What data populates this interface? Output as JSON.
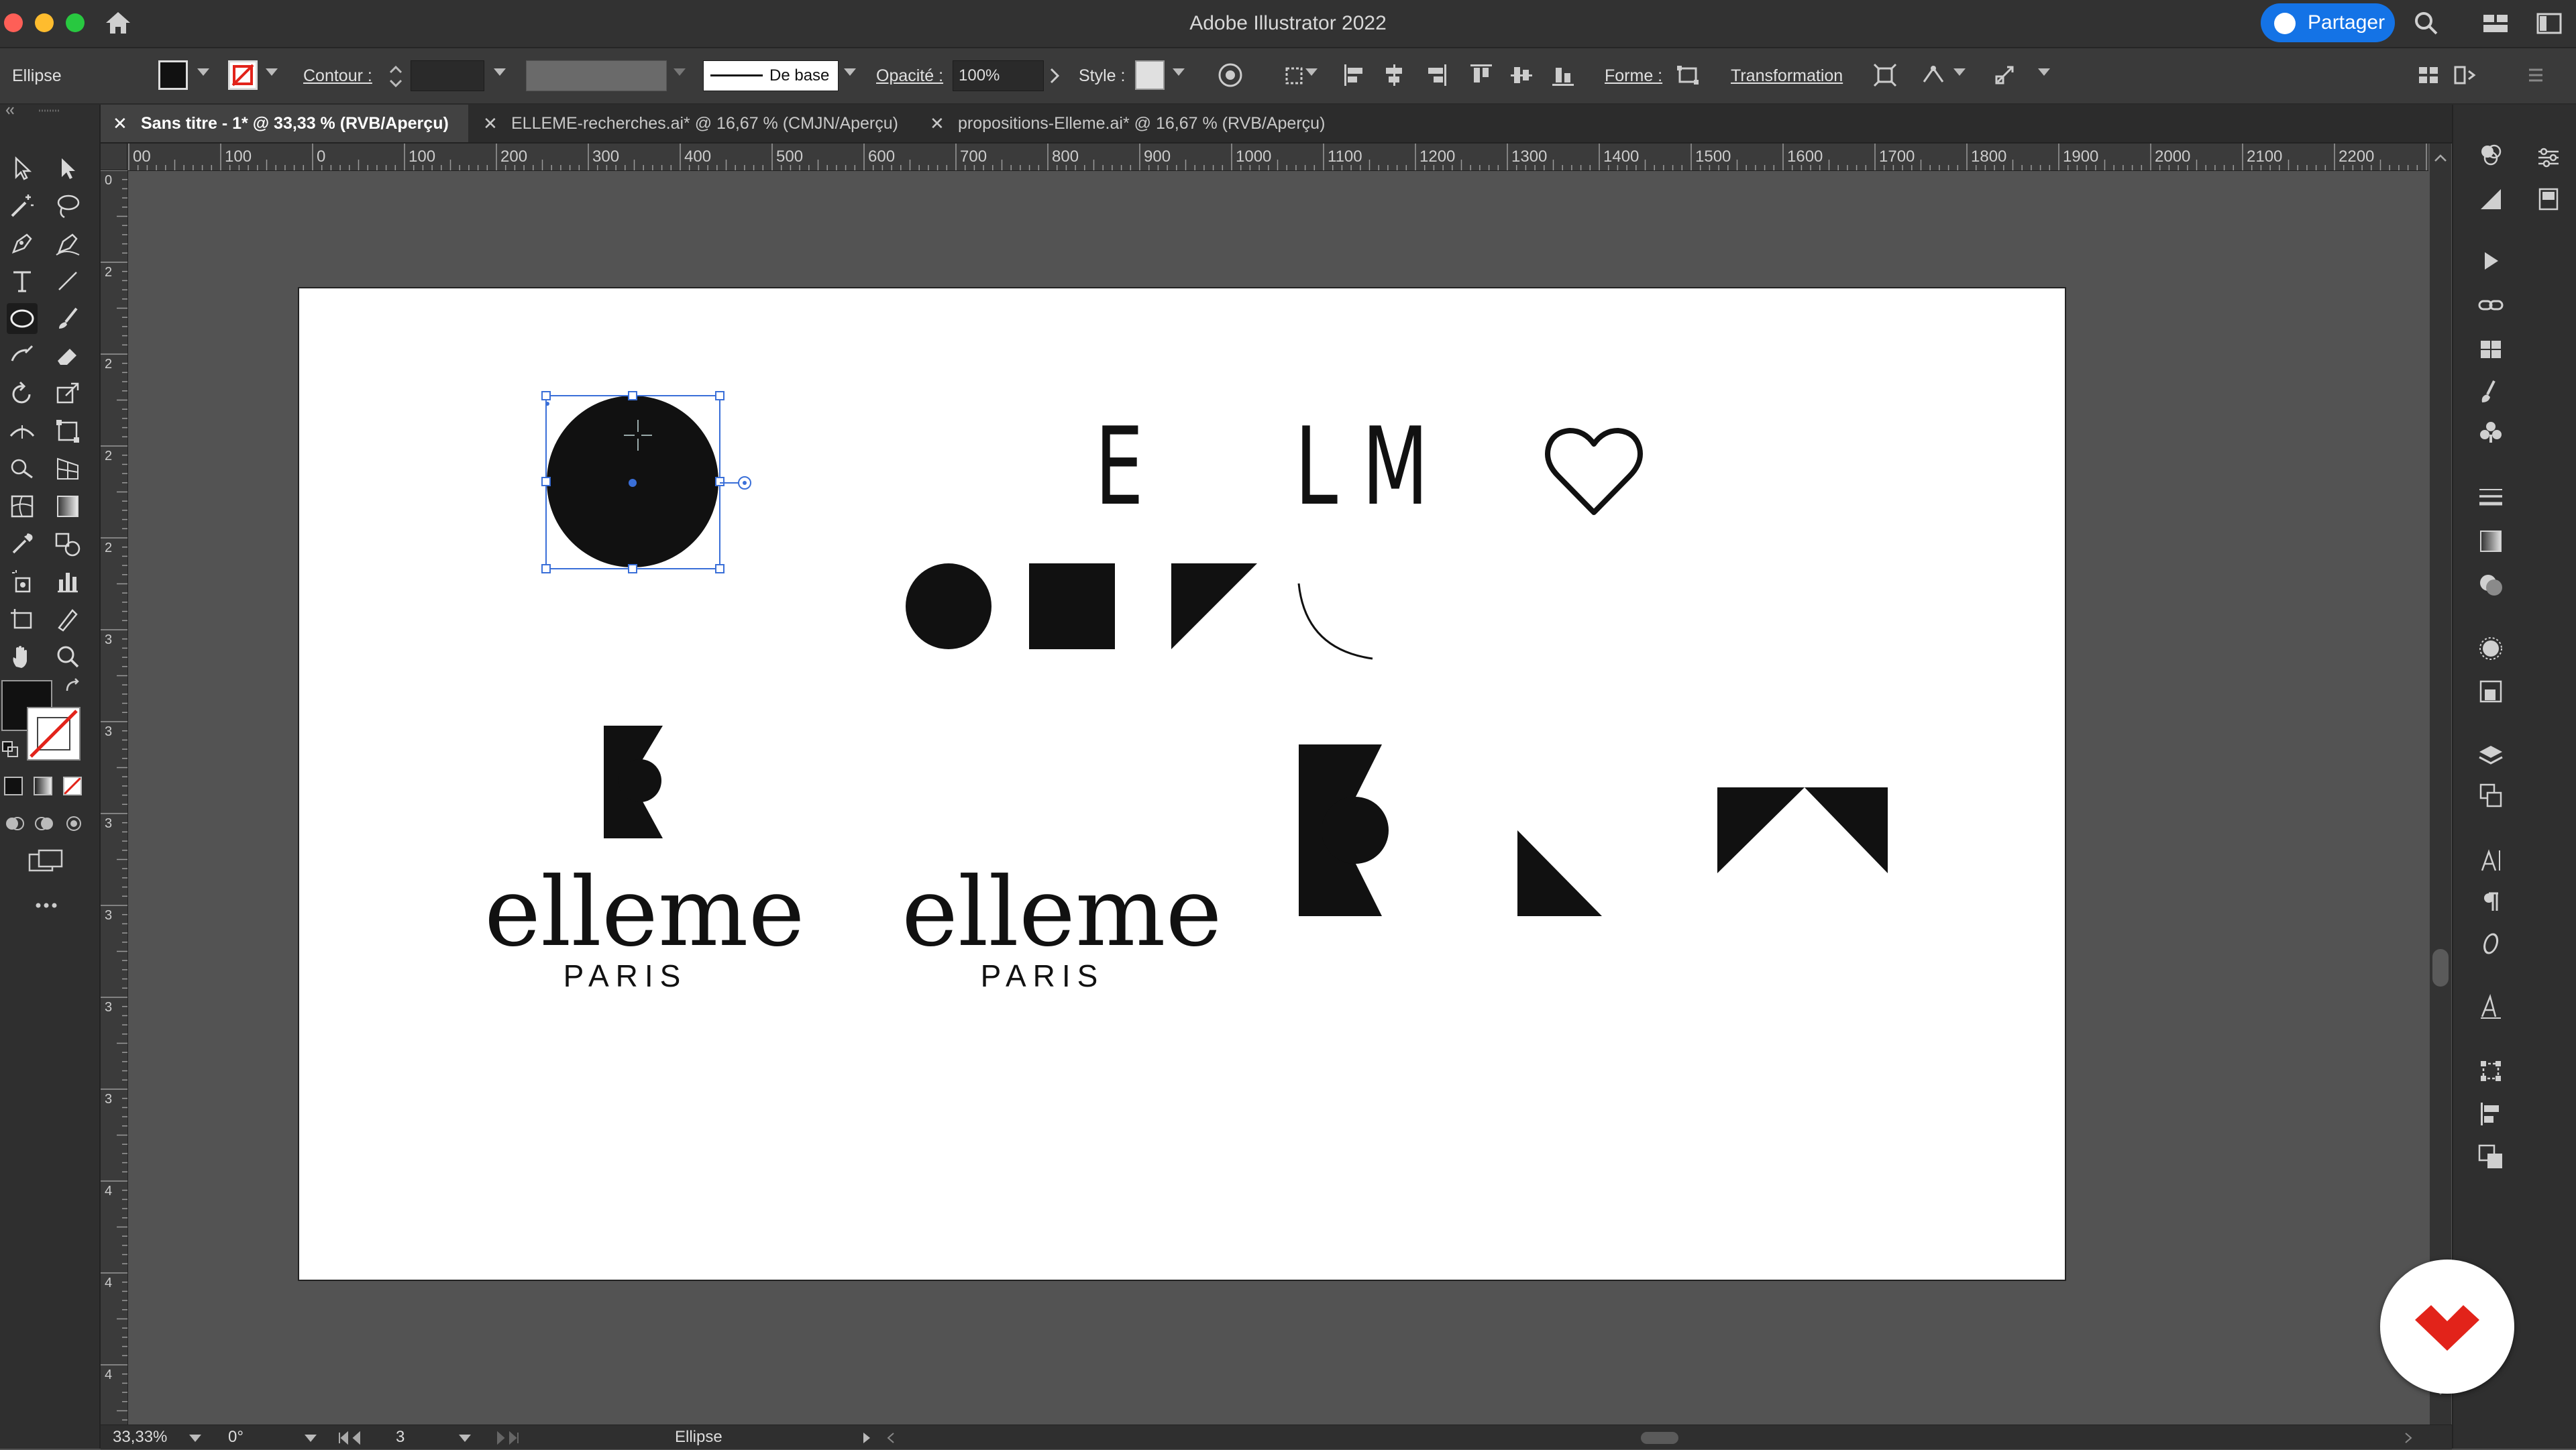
{
  "window": {
    "title": "Adobe Illustrator 2022",
    "share_label": "Partager"
  },
  "controlbar": {
    "selection_label": "Ellipse",
    "stroke_label": "Contour :",
    "brush_value": "De base",
    "opacity_label": "Opacité :",
    "opacity_value": "100%",
    "style_label": "Style :",
    "shape_label": "Forme :",
    "transform_label": "Transformation"
  },
  "tabs": [
    {
      "label": "Sans titre - 1* @ 33,33 % (RVB/Aperçu)",
      "active": true
    },
    {
      "label": "ELLEME-recherches.ai* @ 16,67 % (CMJN/Aperçu)",
      "active": false
    },
    {
      "label": "propositions-Elleme.ai* @ 16,67 % (RVB/Aperçu)",
      "active": false
    }
  ],
  "ruler_h": [
    "00",
    "100",
    "0",
    "100",
    "200",
    "300",
    "400",
    "500",
    "600",
    "700",
    "800",
    "900",
    "1000",
    "1100",
    "1200",
    "1300",
    "1400",
    "1500",
    "1600",
    "1700",
    "1800",
    "1900",
    "2000",
    "2100",
    "2200",
    "2"
  ],
  "ruler_v": [
    "0",
    "2",
    "2",
    "2",
    "2",
    "3",
    "3",
    "3",
    "3",
    "3",
    "3",
    "4",
    "4",
    "4"
  ],
  "artboard": {
    "letters_e": "E",
    "letters_lm": "LM",
    "wordmark_1": "elleme",
    "tagline_1": "PARIS",
    "wordmark_2": "elleme",
    "tagline_2": "PARIS"
  },
  "statusbar": {
    "zoom": "33,33%",
    "rotation": "0°",
    "artboard_number": "3",
    "current_tool": "Ellipse"
  },
  "colors": {
    "fill": "#111111",
    "accent": "#1473e6",
    "brand": "#e2231a",
    "selection": "#3a6fd8"
  }
}
